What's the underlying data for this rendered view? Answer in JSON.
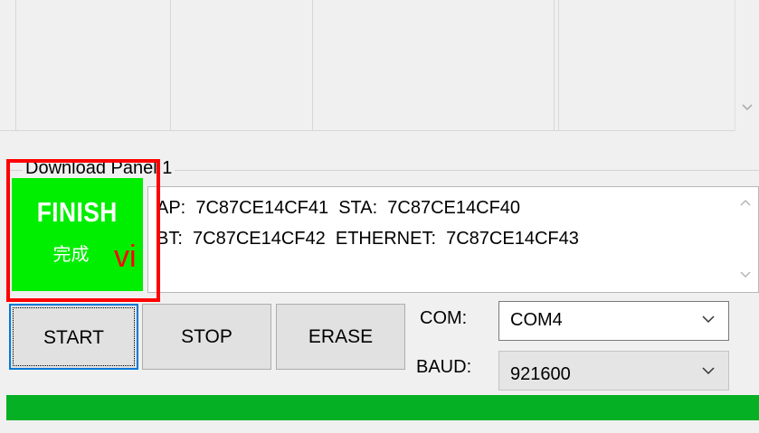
{
  "panel": {
    "title": "Download Panel 1"
  },
  "status": {
    "title": "FINISH",
    "subtitle": "完成",
    "color": "#00ee00",
    "annotation": "vi"
  },
  "info": {
    "line1": "AP:  7C87CE14CF41  STA:  7C87CE14CF40",
    "line2": "BT:  7C87CE14CF42  ETHERNET:  7C87CE14CF43"
  },
  "buttons": {
    "start": "START",
    "stop": "STOP",
    "erase": "ERASE"
  },
  "com": {
    "label": "COM:",
    "value": "COM4"
  },
  "baud": {
    "label": "BAUD:",
    "value": "921600"
  },
  "progress": {
    "percent": 100,
    "color": "#06b025"
  },
  "icons": {
    "scroll_up": "chevron-up-icon",
    "scroll_down": "chevron-down-icon",
    "dropdown": "chevron-down-icon"
  }
}
